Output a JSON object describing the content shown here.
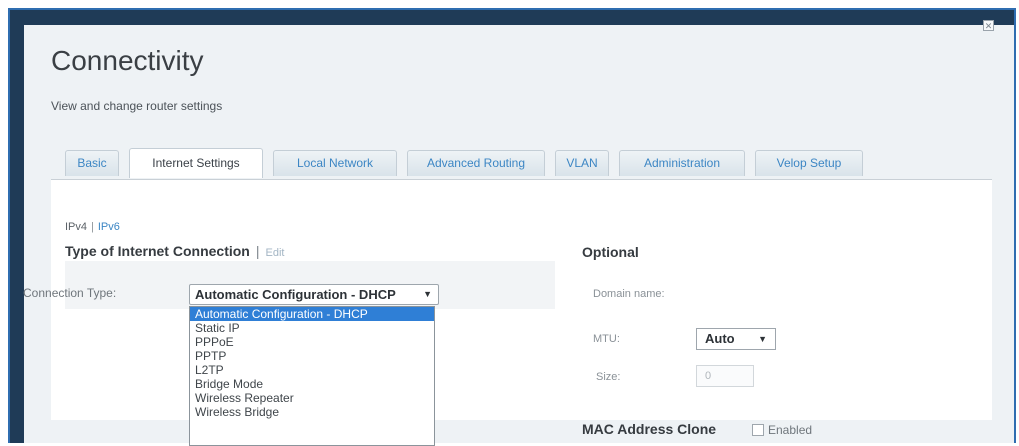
{
  "header": {
    "title": "Connectivity",
    "subtitle": "View and change router settings",
    "close_icon": "close-icon"
  },
  "tabs": [
    {
      "label": "Basic",
      "active": false
    },
    {
      "label": "Internet Settings",
      "active": true
    },
    {
      "label": "Local Network",
      "active": false
    },
    {
      "label": "Advanced Routing",
      "active": false
    },
    {
      "label": "VLAN",
      "active": false
    },
    {
      "label": "Administration",
      "active": false
    },
    {
      "label": "Velop Setup",
      "active": false
    }
  ],
  "ip_version": {
    "ipv4": "IPv4",
    "separator": "|",
    "ipv6": "IPv6"
  },
  "connection": {
    "heading": "Type of Internet Connection",
    "separator": "|",
    "edit_label": "Edit",
    "type_label": "Connection Type:",
    "selected": "Automatic Configuration - DHCP",
    "options": [
      "Automatic Configuration - DHCP",
      "Static IP",
      "PPPoE",
      "PPTP",
      "L2TP",
      "Bridge Mode",
      "Wireless Repeater",
      "Wireless Bridge"
    ]
  },
  "optional": {
    "heading": "Optional",
    "domain_label": "Domain name:",
    "mtu_label": "MTU:",
    "mtu_value": "Auto",
    "size_label": "Size:",
    "size_value": "0"
  },
  "mac_clone": {
    "heading": "MAC Address Clone",
    "enabled_label": "Enabled",
    "checked": false
  },
  "colors": {
    "accent": "#3c86c4",
    "selection": "#2f7fd6",
    "frame": "#2f6db0"
  }
}
